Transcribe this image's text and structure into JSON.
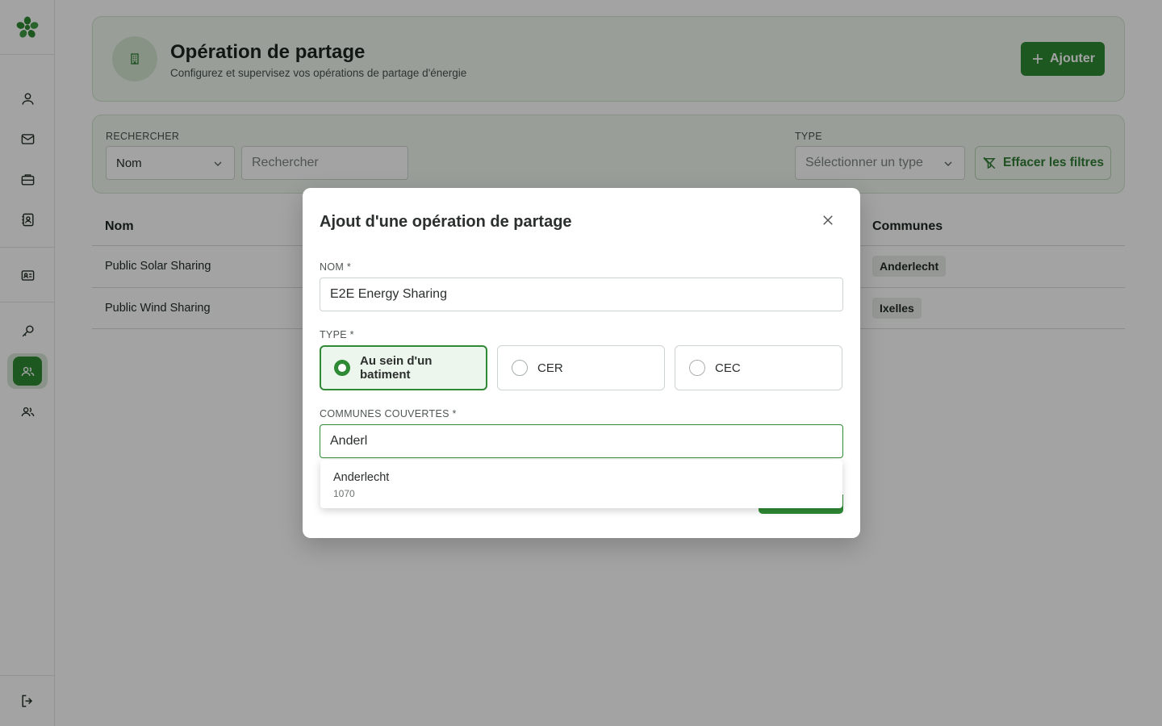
{
  "sidebar": {
    "logo": "app-logo",
    "items": [
      {
        "name": "user",
        "icon": "user-icon"
      },
      {
        "name": "mail",
        "icon": "mail-icon"
      },
      {
        "name": "briefcase",
        "icon": "briefcase-icon"
      },
      {
        "name": "contacts",
        "icon": "contact-book-icon"
      },
      {
        "name": "id-card",
        "icon": "id-card-icon"
      },
      {
        "name": "key",
        "icon": "key-icon"
      },
      {
        "name": "sharing",
        "icon": "users-icon",
        "active": true
      },
      {
        "name": "members",
        "icon": "users-icon"
      }
    ],
    "logout_icon": "logout-icon"
  },
  "header": {
    "title": "Opération de partage",
    "subtitle": "Configurez et supervisez vos opérations de partage d'énergie",
    "add_label": "Ajouter",
    "icon": "building-icon"
  },
  "filters": {
    "search_label": "RECHERCHER",
    "field_select_value": "Nom",
    "search_placeholder": "Rechercher",
    "type_label": "TYPE",
    "type_placeholder": "Sélectionner un type",
    "clear_label": "Effacer les filtres"
  },
  "table": {
    "columns": [
      "Nom",
      "Communes"
    ],
    "rows": [
      {
        "name": "Public Solar Sharing",
        "commune": "Anderlecht"
      },
      {
        "name": "Public Wind Sharing",
        "commune": "Ixelles"
      }
    ]
  },
  "modal": {
    "title": "Ajout d'une opération de partage",
    "name_label": "NOM *",
    "name_value": "E2E Energy Sharing",
    "type_label": "TYPE *",
    "type_options": [
      "Au sein d'un batiment",
      "CER",
      "CEC"
    ],
    "type_selected": "Au sein d'un batiment",
    "communes_label": "COMMUNES COUVERTES *",
    "communes_value": "Anderl",
    "suggestions": [
      {
        "name": "Anderlecht",
        "code": "1070"
      }
    ]
  },
  "colors": {
    "accent": "#2f8a35",
    "card_bg": "#f1f8f0",
    "overlay": "rgba(0,0,0,0.36)"
  }
}
